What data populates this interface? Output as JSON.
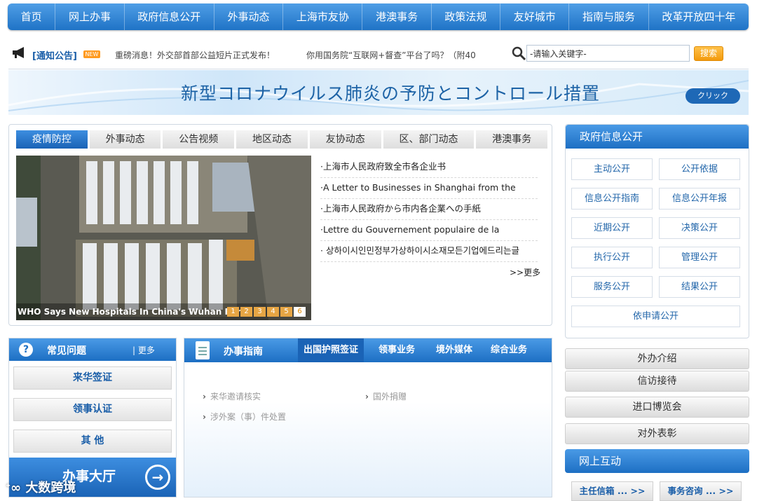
{
  "nav": [
    "首页",
    "网上办事",
    "政府信息公开",
    "外事动态",
    "上海市友协",
    "港澳事务",
    "政策法规",
    "友好城市",
    "指南与服务",
    "改革开放四十年"
  ],
  "notice": {
    "title": "[通知公告]",
    "new_badge": "NEW",
    "items": [
      "重磅消息！外交部首部公益短片正式发布！",
      "你用国务院“互联网+督查”平台了吗？（附40"
    ]
  },
  "search": {
    "value": "-请输入关键字-",
    "button": "搜索"
  },
  "banner": {
    "title": "新型コロナウイルス肺炎の予防とコントロール措置",
    "button": "クリック"
  },
  "news": {
    "tabs": [
      "疫情防控",
      "外事动态",
      "公告视频",
      "地区动态",
      "友协动态",
      "区、部门动态",
      "港澳事务"
    ],
    "active_tab": 0,
    "photo_caption": "WHO Says New Hospitals In China's Wuhan Ren",
    "pager": [
      "1",
      "2",
      "3",
      "4",
      "5",
      "6"
    ],
    "current_page": 5,
    "items": [
      "·上海市人民政府致全市各企业书",
      "·A Letter to Businesses in Shanghai from the",
      "·上海市人民政府から市内各企業への手紙",
      "·Lettre du Gouvernement populaire de la",
      "· 상하이시인민정부가상하이시소재모든기업에드리는글"
    ],
    "more": ">>更多"
  },
  "gov": {
    "title": "政府信息公开",
    "buttons": [
      "主动公开",
      "公开依据",
      "信息公开指南",
      "信息公开年报",
      "近期公开",
      "决策公开",
      "执行公开",
      "管理公开",
      "服务公开",
      "结果公开"
    ],
    "wide_button": "依申请公开"
  },
  "faq": {
    "title": "常见问题",
    "more": "| 更多",
    "items": [
      "来华签证",
      "领事认证",
      "其 他"
    ],
    "hall": "办事大厅"
  },
  "guide": {
    "title": "办事指南",
    "tabs": [
      "出国护照签证",
      "领事业务",
      "境外媒体",
      "综合业务"
    ],
    "active_tab": 0,
    "items": [
      "来华邀请核实",
      "国外捐赠",
      "涉外案（事）件处置"
    ]
  },
  "right_links": [
    "外办介绍",
    "信访接待",
    "进口博览会",
    "对外表彰"
  ],
  "interact": {
    "title": "网上互动",
    "buttons": [
      "主任信箱 ... >>",
      "事务咨询 ... >>"
    ]
  },
  "watermark": "大数跨境",
  "colors": {
    "primary_blue": "#1d6fc3",
    "accent_orange": "#f39a0d"
  }
}
